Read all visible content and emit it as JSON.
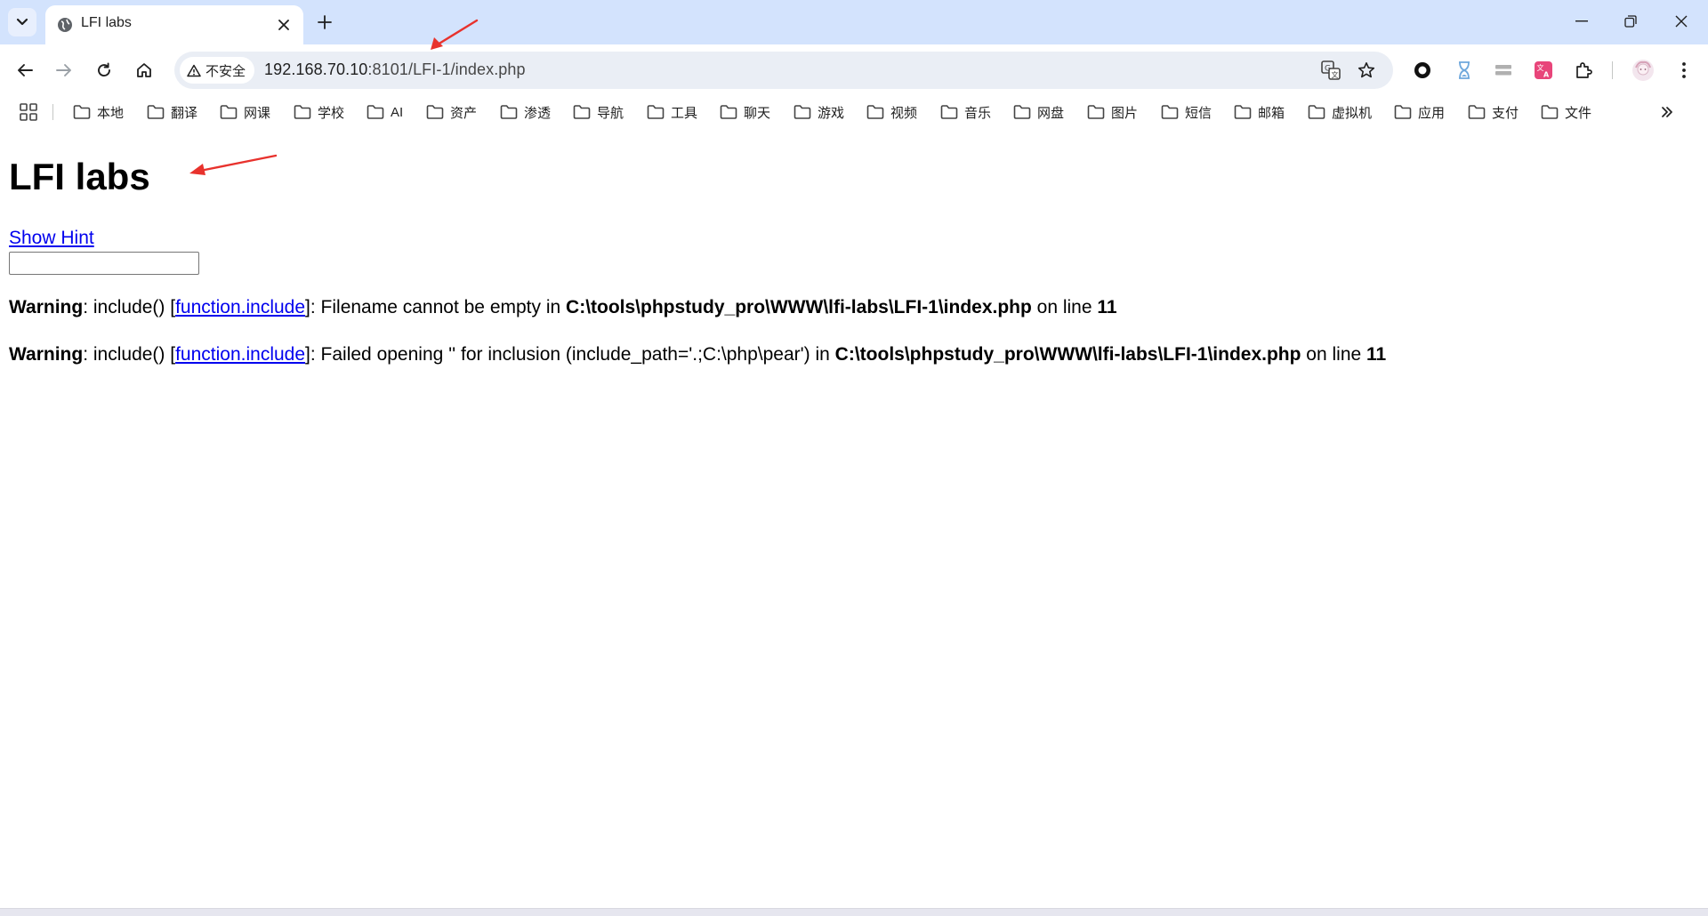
{
  "browser": {
    "tab": {
      "title": "LFI labs"
    },
    "address_bar": {
      "security_label": "不安全",
      "url_host": "192.168.70.10",
      "url_rest": ":8101/LFI-1/index.php"
    },
    "bookmarks": [
      "本地",
      "翻译",
      "网课",
      "学校",
      "AI",
      "资产",
      "渗透",
      "导航",
      "工具",
      "聊天",
      "游戏",
      "视频",
      "音乐",
      "网盘",
      "图片",
      "短信",
      "邮箱",
      "虚拟机",
      "应用",
      "支付",
      "文件"
    ]
  },
  "page": {
    "title": "LFI labs",
    "hint_link": "Show Hint",
    "input_value": "",
    "warnings": [
      {
        "label": "Warning",
        "pre": ": include() [",
        "link": "function.include",
        "msg": "]: Filename cannot be empty in ",
        "path": "C:\\tools\\phpstudy_pro\\WWW\\lfi-labs\\LFI-1\\index.php",
        "on_line": " on line ",
        "line": "11"
      },
      {
        "label": "Warning",
        "pre": ": include() [",
        "link": "function.include",
        "msg": "]: Failed opening '' for inclusion (include_path='.;C:\\php\\pear') in ",
        "path": "C:\\tools\\phpstudy_pro\\WWW\\lfi-labs\\LFI-1\\index.php",
        "on_line": " on line ",
        "line": "11"
      }
    ]
  },
  "colors": {
    "tabstrip": "#d3e3fd",
    "omnibox": "#eaeef5",
    "link": "#0000ee",
    "annotation_arrow": "#e8322d"
  },
  "icons": [
    "tab-search-icon",
    "globe-icon",
    "close-icon",
    "plus-icon",
    "minimize-icon",
    "restore-icon",
    "window-close-icon",
    "back-icon",
    "forward-icon",
    "reload-icon",
    "home-icon",
    "warning-triangle-icon",
    "translate-icon",
    "star-icon",
    "apps-grid-icon",
    "folder-icon",
    "chevron-double-right-icon"
  ]
}
